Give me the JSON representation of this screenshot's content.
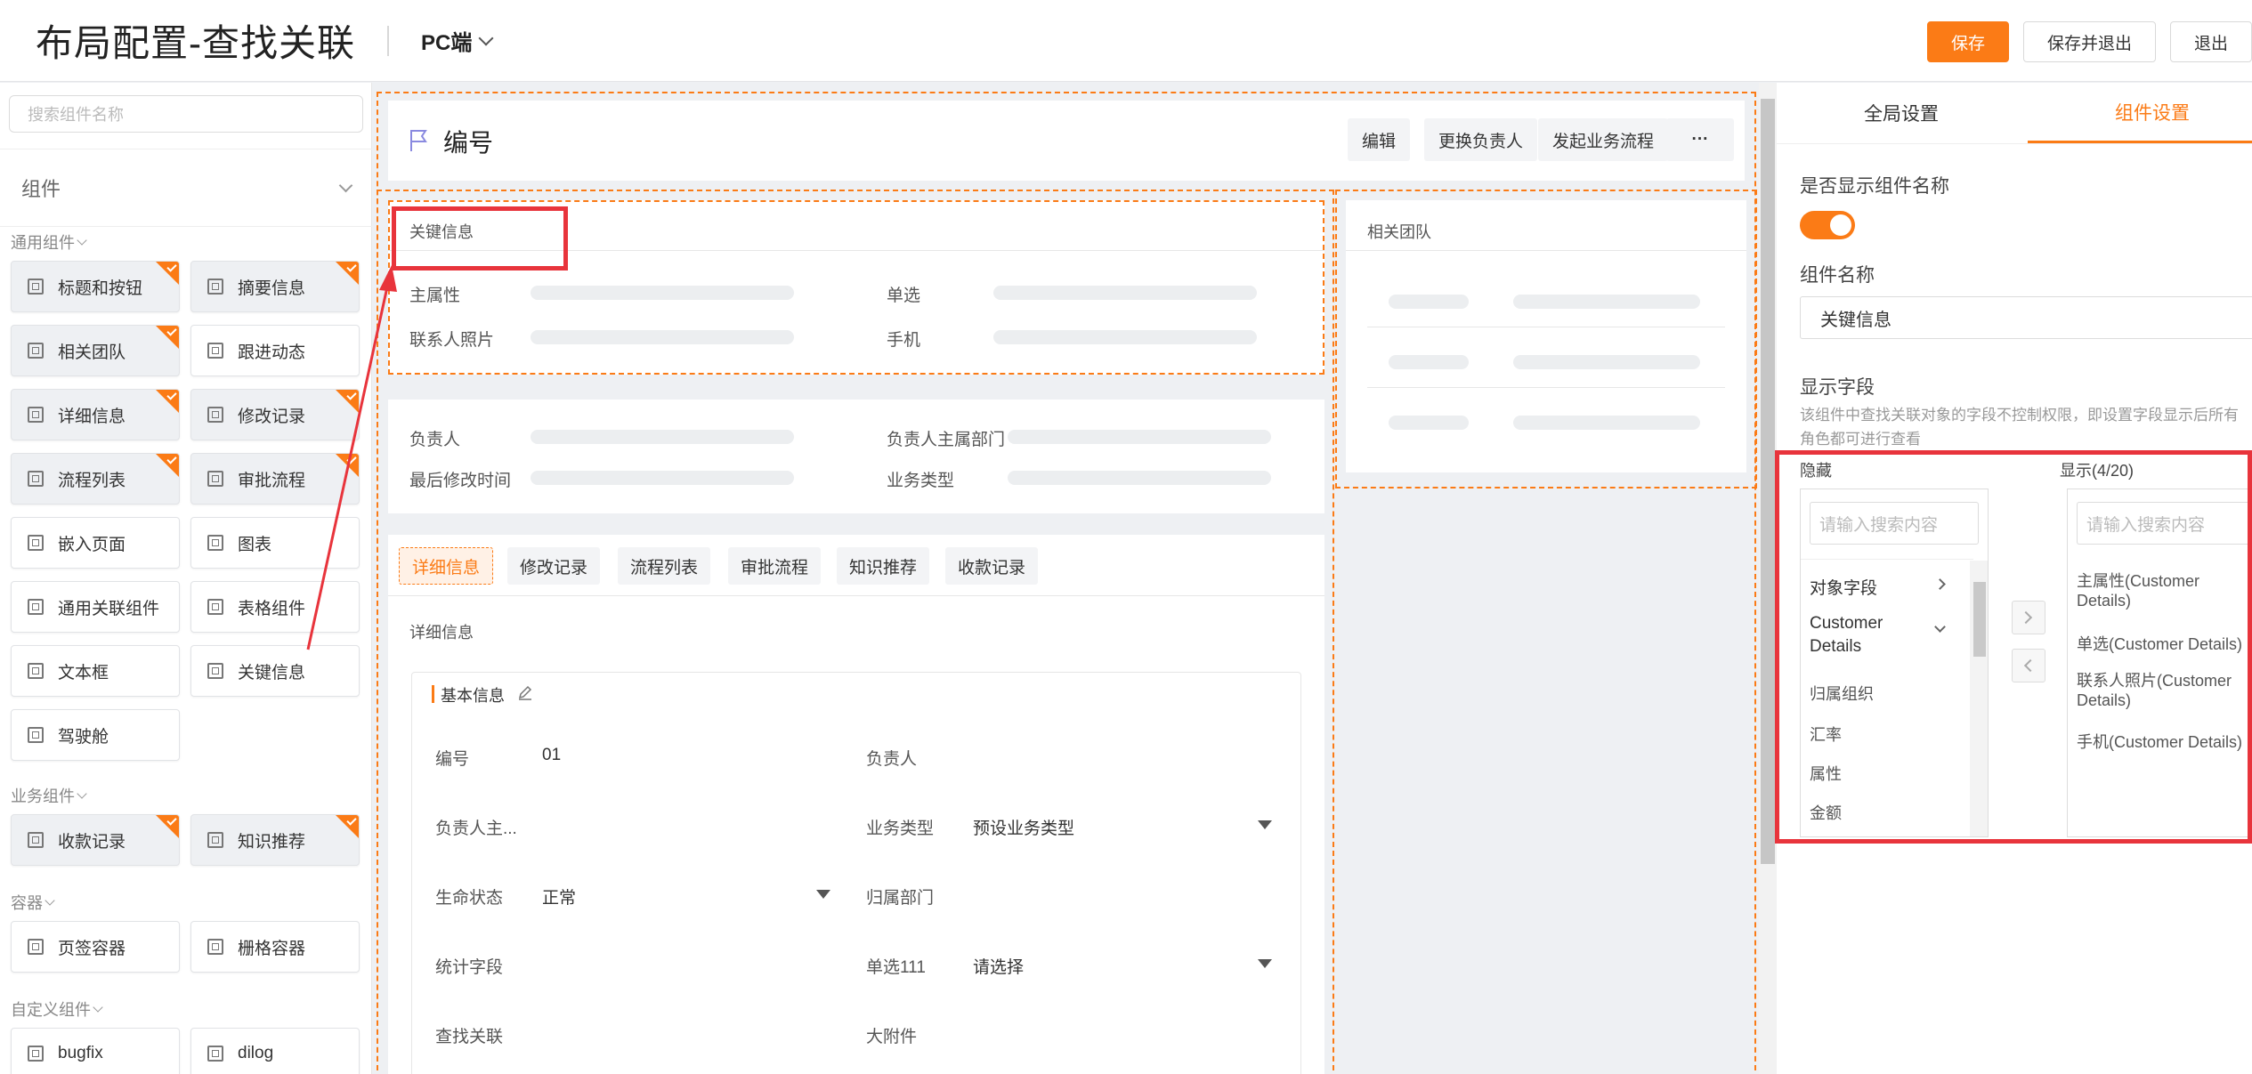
{
  "header": {
    "title": "布局配置-查找关联",
    "device": "PC端",
    "save": "保存",
    "save_exit": "保存并退出",
    "exit": "退出"
  },
  "left": {
    "search_placeholder": "搜索组件名称",
    "components_label": "组件",
    "groups": {
      "general": "通用组件",
      "business": "业务组件",
      "container": "容器",
      "custom": "自定义组件"
    },
    "general_items": [
      {
        "label": "标题和按钮",
        "used": true
      },
      {
        "label": "摘要信息",
        "used": true
      },
      {
        "label": "相关团队",
        "used": true
      },
      {
        "label": "跟进动态",
        "used": false
      },
      {
        "label": "详细信息",
        "used": true
      },
      {
        "label": "修改记录",
        "used": true
      },
      {
        "label": "流程列表",
        "used": true
      },
      {
        "label": "审批流程",
        "used": true
      },
      {
        "label": "嵌入页面",
        "used": false
      },
      {
        "label": "图表",
        "used": false
      },
      {
        "label": "通用关联组件",
        "used": false
      },
      {
        "label": "表格组件",
        "used": false
      },
      {
        "label": "文本框",
        "used": false
      },
      {
        "label": "关键信息",
        "used": false
      },
      {
        "label": "驾驶舱",
        "used": false
      }
    ],
    "business_items": [
      {
        "label": "收款记录",
        "used": true
      },
      {
        "label": "知识推荐",
        "used": true
      }
    ],
    "container_items": [
      {
        "label": "页签容器",
        "used": false
      },
      {
        "label": "栅格容器",
        "used": false
      }
    ],
    "custom_items": [
      {
        "label": "bugfix",
        "used": false
      },
      {
        "label": "dilog",
        "used": false
      }
    ]
  },
  "canvas": {
    "record_title": "编号",
    "action_buttons": [
      "编辑",
      "更换负责人",
      "发起业务流程",
      "···"
    ],
    "key_info_title": "关键信息",
    "key_fields": [
      "主属性",
      "单选",
      "联系人照片",
      "手机"
    ],
    "related_team_title": "相关团队",
    "summary_fields": [
      "负责人",
      "负责人主属部门",
      "最后修改时间",
      "业务类型"
    ],
    "tabs": [
      "详细信息",
      "修改记录",
      "流程列表",
      "审批流程",
      "知识推荐",
      "收款记录"
    ],
    "detail_title": "详细信息",
    "section_title": "基本信息",
    "form": {
      "l1_label": "编号",
      "l1_value": "01",
      "r1_label": "负责人",
      "l2_label": "负责人主...",
      "r2_label": "业务类型",
      "r2_value": "预设业务类型",
      "l3_label": "生命状态",
      "l3_value": "正常",
      "r3_label": "归属部门",
      "l4_label": "统计字段",
      "r4_label": "单选111",
      "r4_value": "请选择",
      "l5_label": "查找关联",
      "r5_label": "大附件"
    }
  },
  "right": {
    "tab_global": "全局设置",
    "tab_component": "组件设置",
    "show_name_label": "是否显示组件名称",
    "toggle_on": true,
    "name_label": "组件名称",
    "name_value": "关键信息",
    "fields_label": "显示字段",
    "hint": "该组件中查找关联对象的字段不控制权限，即设置字段显示后所有角色都可进行查看",
    "hidden_title": "隐藏",
    "shown_title": "显示(4/20)",
    "search_placeholder": "请输入搜索内容",
    "hidden_items": [
      "对象字段",
      "Customer Details",
      "归属组织",
      "汇率",
      "属性",
      "金额"
    ],
    "shown_items": [
      "主属性(Customer Details)",
      "单选(Customer Details)",
      "联系人照片(Customer Details)",
      "手机(Customer Details)"
    ]
  },
  "colors": {
    "accent": "#fb7b16",
    "highlight": "#e8343c"
  }
}
